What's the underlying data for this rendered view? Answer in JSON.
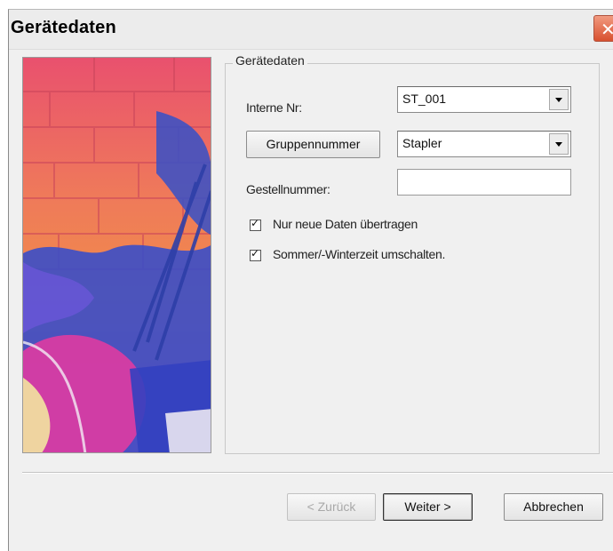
{
  "window": {
    "title": "Gerätedaten",
    "close_glyph": "✕"
  },
  "group": {
    "legend": "Gerätedaten",
    "interne_nr": {
      "label": "Interne Nr:",
      "value": "ST_001"
    },
    "gruppe": {
      "button_label": "Gruppennummer",
      "value": "Stapler"
    },
    "gestell": {
      "label": "Gestellnummer:",
      "value": ""
    },
    "checkboxes": [
      {
        "label": "Nur neue Daten übertragen",
        "checked": true
      },
      {
        "label": "Sommer/-Winterzeit umschalten.",
        "checked": true
      }
    ]
  },
  "footer": {
    "back_label": "< Zurück",
    "next_label": "Weiter >",
    "cancel_label": "Abbrechen"
  },
  "icons": {
    "close": "close-icon",
    "dropdown": "chevron-down-icon"
  },
  "colors": {
    "close_button": "#d8502f",
    "dialog_bg": "#f0f0f0"
  }
}
